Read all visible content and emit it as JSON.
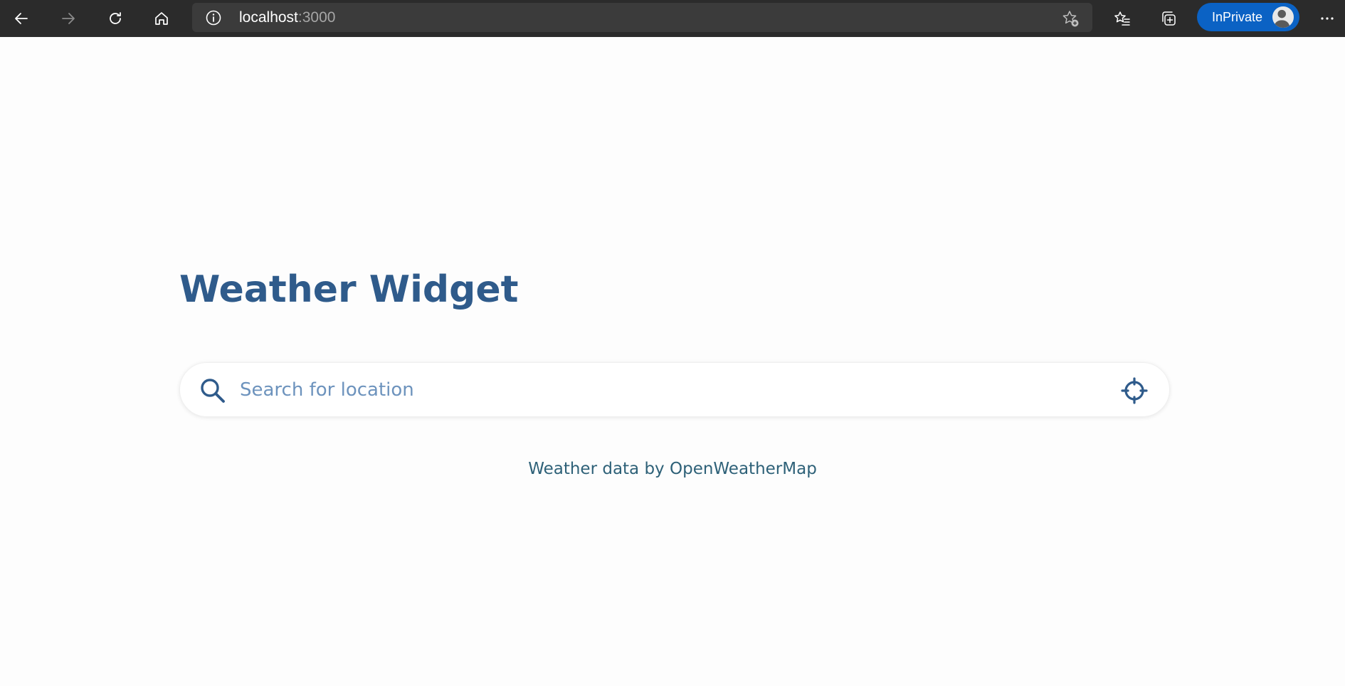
{
  "browser": {
    "address": {
      "host": "localhost",
      "port": ":3000"
    },
    "profile_label": "InPrivate",
    "colors": {
      "toolbar": "#2b2b2b",
      "addressbar": "#3b3b3b",
      "inprivate_badge": "#0b62c4"
    },
    "icons": {
      "back": "arrow-left-icon",
      "forward": "arrow-right-icon",
      "refresh": "refresh-icon",
      "home": "home-icon",
      "site_info": "info-icon",
      "add_favorite": "star-plus-icon",
      "favorites": "favorites-icon",
      "collections": "collections-icon",
      "more": "more-icon"
    }
  },
  "page": {
    "title": "Weather Widget",
    "search": {
      "placeholder": "Search for location",
      "value": ""
    },
    "credit": {
      "prefix": "Weather data by ",
      "link": "OpenWeatherMap"
    },
    "colors": {
      "title": "#2f5b8b",
      "placeholder": "#6d93bd",
      "credit": "#2e6178",
      "background": "#fdfdfd"
    }
  }
}
